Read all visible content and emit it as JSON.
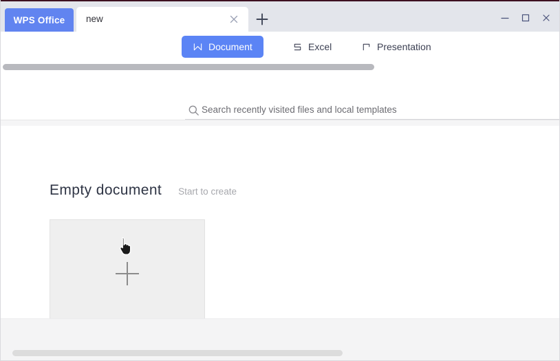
{
  "window": {
    "app_badge": "WPS Office",
    "controls": [
      {
        "name": "minimize",
        "icon": "minimize-icon"
      },
      {
        "name": "maximize",
        "icon": "maximize-icon"
      },
      {
        "name": "close",
        "icon": "close-icon"
      }
    ]
  },
  "tabs": {
    "open": [
      {
        "label": "new",
        "active": true,
        "close_icon": "close-icon"
      }
    ],
    "new_tab_icon": "plus-icon"
  },
  "categories": [
    {
      "label": "Document",
      "icon": "wps-writer-icon",
      "active": true
    },
    {
      "label": "Excel",
      "icon": "wps-spreadsheet-icon",
      "active": false
    },
    {
      "label": "Presentation",
      "icon": "wps-presentation-icon",
      "active": false
    }
  ],
  "search": {
    "icon": "search-icon",
    "placeholder": "Search recently visited files and local templates",
    "value": ""
  },
  "main": {
    "heading": "Empty document",
    "subheading": "Start to create",
    "blank_card": {
      "name": "new-blank-document",
      "icon": "plus-icon"
    }
  },
  "cursor": {
    "icon": "hand-pointer-cursor"
  },
  "colors": {
    "accent_blue": "#5b84f5",
    "badge_blue": "#6184f0",
    "titlebar_gray": "#e3e5eb",
    "card_gray": "#efefef",
    "top_accent": "#3d1020",
    "scroll_top": "#b8b9be",
    "scroll_bottom": "#dcdcdc"
  }
}
